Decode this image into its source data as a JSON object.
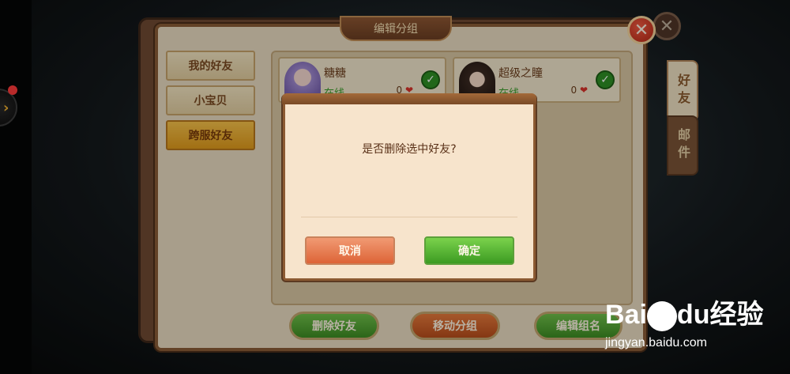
{
  "panel": {
    "title": "编辑分组",
    "close_icon": "close-icon"
  },
  "side_tabs": [
    "好友",
    "邮件"
  ],
  "groups": [
    {
      "label": "我的好友",
      "active": false
    },
    {
      "label": "小宝贝",
      "active": false
    },
    {
      "label": "跨服好友",
      "active": true
    }
  ],
  "friends": [
    {
      "name": "糖糖",
      "status": "在线",
      "hearts": "0",
      "checked": true
    },
    {
      "name": "超级之瞳",
      "status": "在线",
      "hearts": "0",
      "checked": true
    }
  ],
  "actions": {
    "delete_label": "删除好友",
    "move_label": "移动分组",
    "rename_label": "编辑组名"
  },
  "dialog": {
    "message": "是否删除选中好友?",
    "cancel_label": "取消",
    "confirm_label": "确定"
  },
  "watermark": {
    "logo_text": "Bai",
    "logo_text2": "du",
    "logo_cn": "经验",
    "url": "jingyan.baidu.com"
  },
  "colors": {
    "accent_green": "#3c9b22",
    "accent_orange": "#dd6437",
    "panel_bg": "#e9dcc1"
  }
}
